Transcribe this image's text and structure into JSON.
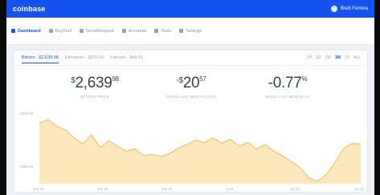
{
  "app": {
    "name": "coinbase",
    "user": "Brett Ferrera"
  },
  "nav": {
    "items": [
      {
        "label": "Dashboard",
        "icon": "dashboard-icon",
        "active": true
      },
      {
        "label": "Buy/Sell",
        "icon": "buy-sell-icon",
        "active": false
      },
      {
        "label": "Send/Request",
        "icon": "send-icon",
        "active": false
      },
      {
        "label": "Accounts",
        "icon": "accounts-icon",
        "active": false
      },
      {
        "label": "Tools",
        "icon": "tools-icon",
        "active": false
      },
      {
        "label": "Settings",
        "icon": "settings-icon",
        "active": false
      }
    ]
  },
  "chart_tabs": [
    {
      "label": "Bitcoin · $2,639.98",
      "active": true
    },
    {
      "label": "Ethereum · $370.60",
      "active": false
    },
    {
      "label": "Litecoin · $49.91",
      "active": false
    }
  ],
  "ranges": [
    "1H",
    "1D",
    "1W",
    "1M",
    "1Y",
    "ALL"
  ],
  "active_range": "1M",
  "stats": {
    "price": {
      "currency": "$",
      "whole": "2,639",
      "cents": "98",
      "label": "BITCOIN PRICE"
    },
    "change": {
      "currency": "-$",
      "whole": "20",
      "cents": "57",
      "label": "SINCE LAST MONTH (USD)"
    },
    "percent": {
      "whole": "-0.77",
      "suffix": "%",
      "label": "SINCE LAST MONTH (%)"
    }
  },
  "chart_data": {
    "type": "area",
    "title": "",
    "xlabel": "",
    "ylabel": "",
    "y_ticks": [
      "2848.00",
      "2369.00"
    ],
    "x_ticks": [
      "Jun 20",
      "Jun 25",
      "Jun 30",
      "Jul 5",
      "Jul 10",
      "Jul 15"
    ],
    "ylim": [
      2369,
      2848
    ],
    "values": [
      2780,
      2805,
      2760,
      2735,
      2680,
      2640,
      2700,
      2615,
      2660,
      2625,
      2590,
      2605,
      2560,
      2570,
      2555,
      2575,
      2610,
      2635,
      2665,
      2648,
      2680,
      2645,
      2670,
      2625,
      2650,
      2605,
      2635,
      2590,
      2560,
      2520,
      2480,
      2410,
      2385,
      2430,
      2510,
      2605,
      2642,
      2639
    ],
    "color": "#f7c97d"
  },
  "colors": {
    "brand": "#1652f0",
    "area_fill": "#fde7bd",
    "area_line": "#f4b955"
  }
}
